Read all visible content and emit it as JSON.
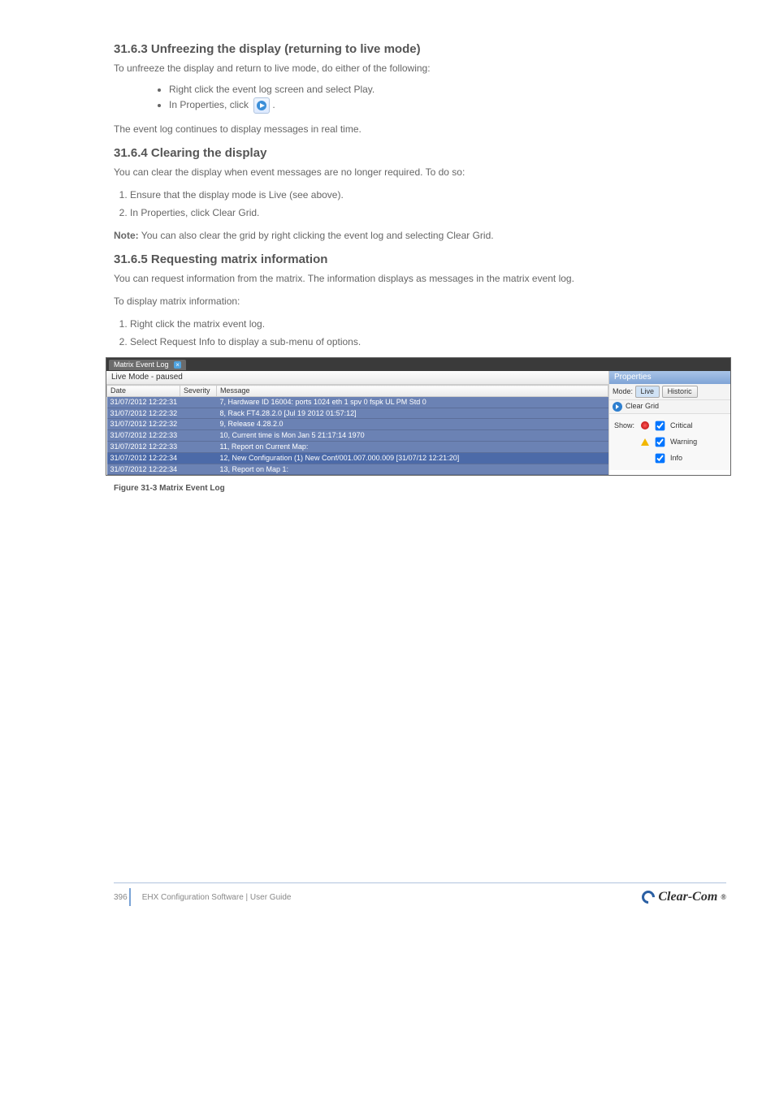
{
  "sections": {
    "s1_title": "31.6.3 Unfreezing the display (returning to live mode)",
    "s1_body_intro": "To unfreeze the display and return to live mode, do either of the following:",
    "s1_bullets": [
      "Right click the event log screen and select Play.",
      "In Properties, click"
    ],
    "s1_after_icon": ".",
    "s1_body_outro": "The event log continues to display messages in real time.",
    "s2_title": "31.6.4 Clearing the display",
    "s2_body_1": "You can clear the display when event messages are no longer required. To do so:",
    "s2_steps": [
      "Ensure that the display mode is Live (see above).",
      "In Properties, click Clear Grid."
    ],
    "s2_note": "You can also clear the grid by right clicking the event log and selecting Clear Grid.",
    "s3_title": "31.6.5 Requesting matrix information",
    "s3_body_1": "You can request information from the matrix. The information displays as messages in the matrix event log.",
    "s3_body_2": "To display matrix information:",
    "s3_steps": [
      "Right click the matrix event log.",
      "Select Request Info to display a sub-menu of options."
    ]
  },
  "screenshot": {
    "tab_label": "Matrix Event Log",
    "mode_label": "Live Mode - paused",
    "properties_title": "Properties",
    "mode_word": "Mode:",
    "live_btn": "Live",
    "historic_btn": "Historic",
    "clear_grid_btn": "Clear Grid",
    "show_label": "Show:",
    "critical": "Critical",
    "warning": "Warning",
    "info": "Info",
    "columns": [
      "Date",
      "Severity",
      "Message"
    ],
    "rows": [
      {
        "date": "31/07/2012 12:22:31",
        "sev": "",
        "msg": "7, Hardware ID 16004: ports 1024  eth 1  spv 0  fspk UL PM Std 0"
      },
      {
        "date": "31/07/2012 12:22:32",
        "sev": "",
        "msg": "8, Rack FT4.28.2.0 [Jul 19 2012 01:57:12]"
      },
      {
        "date": "31/07/2012 12:22:32",
        "sev": "",
        "msg": "9, Release 4.28.2.0"
      },
      {
        "date": "31/07/2012 12:22:33",
        "sev": "",
        "msg": "10, Current time is Mon Jan  5 21:17:14 1970"
      },
      {
        "date": "31/07/2012 12:22:33",
        "sev": "",
        "msg": "11, Report on Current Map:"
      },
      {
        "date": "31/07/2012 12:22:34",
        "sev": "",
        "msg": "12,    New Configuration     (1) New Conf/001.007.000.009 [31/07/12 12:21:20]",
        "sel": true
      },
      {
        "date": "31/07/2012 12:22:34",
        "sev": "",
        "msg": "13, Report on Map 1:"
      }
    ]
  },
  "figure_caption": "Figure 31-3 Matrix Event Log",
  "footer": {
    "page": "396",
    "doc": "EHX Configuration Software | User Guide",
    "brand": "Clear-Com",
    "reg": "®"
  }
}
